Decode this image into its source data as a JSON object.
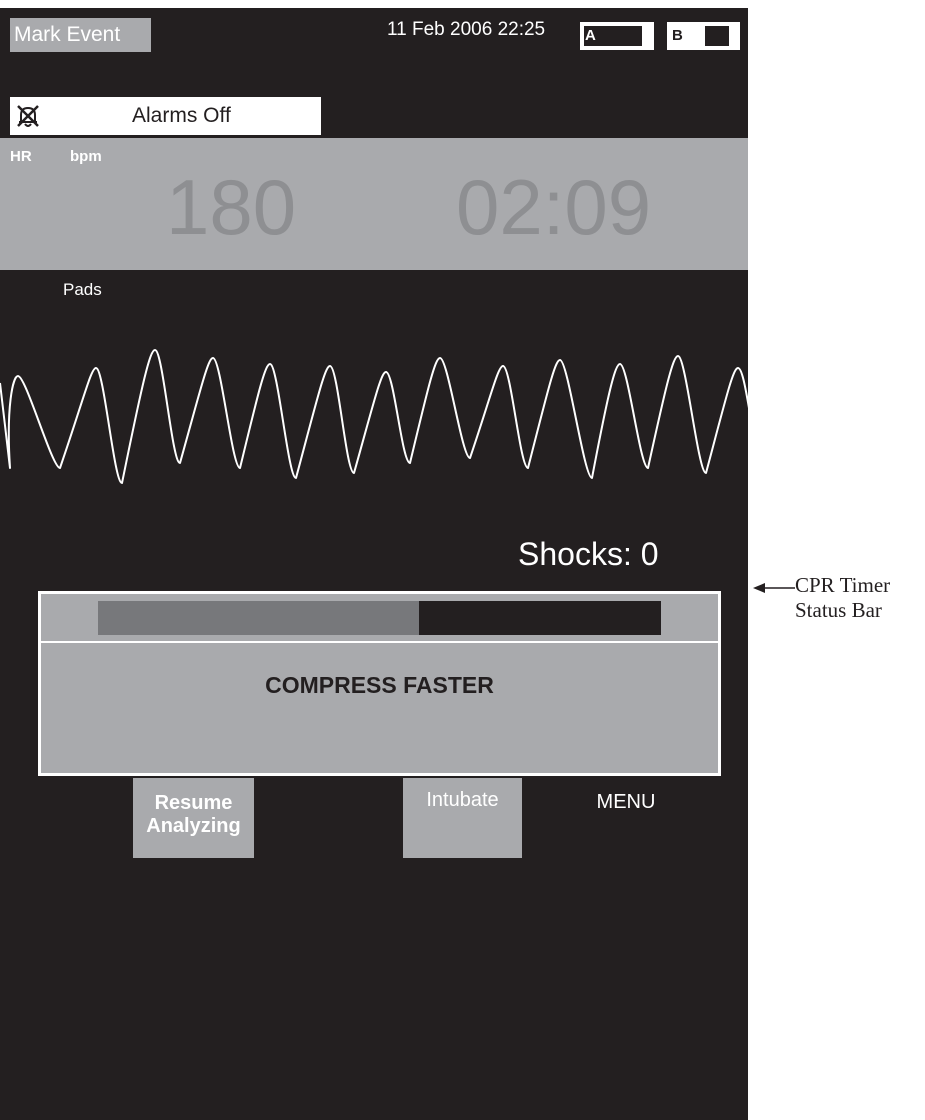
{
  "top_bar": {
    "mark_event_label": "Mark Event",
    "datetime": "11 Feb 2006 22:25",
    "battery_a_label": "A",
    "battery_b_label": "B"
  },
  "alarm_banner": {
    "icon": "alarm-off-icon",
    "text": "Alarms Off"
  },
  "vitals": {
    "hr_label": "HR",
    "hr_unit": "bpm",
    "hr_value": "180",
    "elapsed_time": "02:09"
  },
  "waveform": {
    "lead_label": "Pads"
  },
  "shocks": {
    "label": "Shocks: 0"
  },
  "cpr": {
    "progress_fraction": 0.57,
    "message": "COMPRESS FASTER"
  },
  "softkeys": {
    "resume_line1": "Resume",
    "resume_line2": "Analyzing",
    "intubate": "Intubate",
    "menu": "MENU"
  },
  "annotation": {
    "line1": "CPR Timer",
    "line2": "Status Bar"
  },
  "colors": {
    "screen_bg": "#231f20",
    "panel_gray": "#a9aaad",
    "value_gray": "#8e8f92",
    "progress_fill": "#77787b"
  }
}
